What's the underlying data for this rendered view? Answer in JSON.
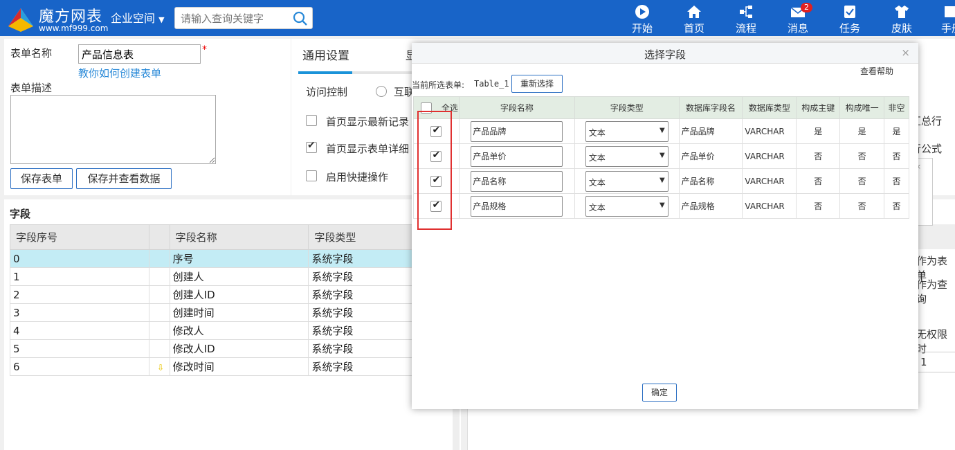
{
  "header": {
    "logo_title": "魔方网表",
    "logo_url": "www.mf999.com",
    "company_menu": "企业空间",
    "search_placeholder": "请输入查询关键字",
    "nav": [
      {
        "label": "开始",
        "icon": "play-icon"
      },
      {
        "label": "首页",
        "icon": "home-icon"
      },
      {
        "label": "流程",
        "icon": "flow-icon"
      },
      {
        "label": "消息",
        "icon": "mail-icon",
        "badge": "2"
      },
      {
        "label": "任务",
        "icon": "task-icon"
      },
      {
        "label": "皮肤",
        "icon": "shirt-icon"
      },
      {
        "label": "手册",
        "icon": "book-icon"
      }
    ]
  },
  "form": {
    "name_label": "表单名称",
    "name_value": "产品信息表",
    "required_mark": "*",
    "howto_link": "教你如何创建表单",
    "desc_label": "表单描述",
    "save_button": "保存表单",
    "save_view_button": "保存并查看数据"
  },
  "settings": {
    "tab_general": "通用设置",
    "tab_display": "显",
    "access_label": "访问控制",
    "radio_partial": "互联",
    "option1": "首页显示最新记录",
    "option2": "首页显示表单详细",
    "option3": "启用快捷操作",
    "peek_right1": "汇总行",
    "peek_right2": "行公式"
  },
  "fields": {
    "title": "字段",
    "columns": [
      "字段序号",
      "",
      "字段名称",
      "字段类型"
    ],
    "rows": [
      {
        "no": "0",
        "name": "序号",
        "type": "系统字段"
      },
      {
        "no": "1",
        "name": "创建人",
        "type": "系统字段"
      },
      {
        "no": "2",
        "name": "创建人ID",
        "type": "系统字段"
      },
      {
        "no": "3",
        "name": "创建时间",
        "type": "系统字段"
      },
      {
        "no": "4",
        "name": "修改人",
        "type": "系统字段"
      },
      {
        "no": "5",
        "name": "修改人ID",
        "type": "系统字段"
      },
      {
        "no": "6",
        "name": "修改时间",
        "type": "系统字段"
      }
    ],
    "peek": [
      "作为表单",
      "作为查询",
      "无权限时",
      "1"
    ]
  },
  "modal": {
    "title": "选择字段",
    "close": "×",
    "help": "查看帮助",
    "current_label": "当前所选表单:",
    "current_value": "Table_1",
    "reselect_button": "重新选择",
    "columns": [
      "全选",
      "字段名称",
      "字段类型",
      "数据库字段名",
      "数据库类型",
      "构成主键",
      "构成唯一",
      "非空"
    ],
    "rows": [
      {
        "checked": true,
        "name": "产品品牌",
        "type": "文本",
        "db_name": "产品品牌",
        "db_type": "VARCHAR",
        "pk": "是",
        "unique": "是",
        "notnull": "是"
      },
      {
        "checked": true,
        "name": "产品单价",
        "type": "文本",
        "db_name": "产品单价",
        "db_type": "VARCHAR",
        "pk": "否",
        "unique": "否",
        "notnull": "否"
      },
      {
        "checked": true,
        "name": "产品名称",
        "type": "文本",
        "db_name": "产品名称",
        "db_type": "VARCHAR",
        "pk": "否",
        "unique": "否",
        "notnull": "否"
      },
      {
        "checked": true,
        "name": "产品规格",
        "type": "文本",
        "db_name": "产品规格",
        "db_type": "VARCHAR",
        "pk": "否",
        "unique": "否",
        "notnull": "否"
      }
    ],
    "confirm_button": "确定"
  },
  "colors": {
    "header_bg": "#1864c8",
    "accent": "#1a93d9",
    "selected_row": "#c3ecf5",
    "highlight_box": "#e03030"
  }
}
